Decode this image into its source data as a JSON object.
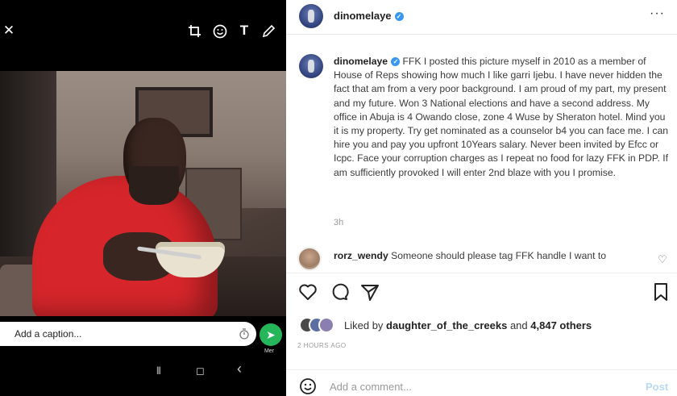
{
  "media_editor": {
    "toolbar": {
      "close_glyph": "✕",
      "text_glyph": "T"
    },
    "caption": {
      "placeholder": "Add a caption..."
    },
    "send_glyph": "➤",
    "recipient_label": "Mer",
    "nav": {
      "recents_glyph": "|||",
      "home_glyph": "◻",
      "back_glyph": "‹"
    }
  },
  "post": {
    "header": {
      "username": "dinomelaye",
      "verified_glyph": "✓",
      "more_glyph": "···"
    },
    "caption": {
      "username": "dinomelaye",
      "verified_glyph": "✓",
      "text": "FFK I posted this picture myself in 2010 as a member of House of Reps showing how much I like garri Ijebu. I have never hidden the fact that am from a very poor background. I am proud of my part, my present and my future. Won 3 National elections and have a second address. My office in Abuja is 4 Owando close, zone 4 Wuse by Sheraton hotel. Mind you it is my property. Try get nominated as a counselor b4 you can face me. I can hire you and pay you upfront 10Years salary. Never been invited by Efcc or Icpc. Face your corruption charges as I repeat no food for lazy FFK in PDP. If am sufficiently provoked I will enter 2nd blaze with you I promise.",
      "time": "3h"
    },
    "comment": {
      "username": "rorz_wendy",
      "text": "Someone should please tag FFK handle I want to",
      "like_glyph": "♡"
    },
    "likes": {
      "prefix": "Liked by",
      "first_user": "daughter_of_the_creeks",
      "and": "and",
      "others": "4,847 others"
    },
    "date": "2 HOURS AGO",
    "add_comment": {
      "placeholder": "Add a comment...",
      "post_label": "Post"
    }
  },
  "colors": {
    "verified": "#3897f0",
    "send_button": "#25b65a",
    "post_button_disabled": "#b8d9f7",
    "shirt_red": "#d6262b"
  },
  "icons": [
    "close-icon",
    "crop-rotate-icon",
    "emoji-icon",
    "text-icon",
    "pencil-icon",
    "timer-icon",
    "send-icon",
    "heart-icon",
    "comment-icon",
    "share-icon",
    "bookmark-icon",
    "more-icon"
  ]
}
